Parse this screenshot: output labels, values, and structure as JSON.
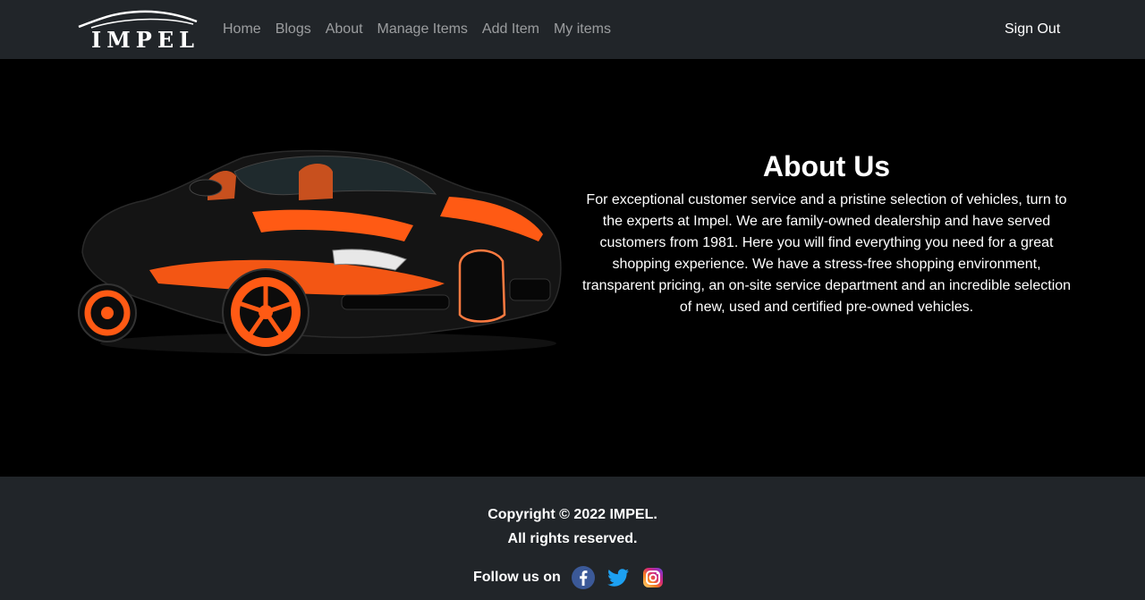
{
  "brand": {
    "name": "IMPEL"
  },
  "nav": {
    "links": [
      "Home",
      "Blogs",
      "About",
      "Manage Items",
      "Add Item",
      "My items"
    ],
    "sign_out": "Sign Out"
  },
  "about": {
    "title": "About Us",
    "text": "For exceptional customer service and a pristine selection of vehicles, turn to the experts at Impel. We are family-owned dealership and have served customers from 1981. Here you will find everything you need for a great shopping experience. We have a stress-free shopping environment, transparent pricing, an on-site service department and an incredible selection of new, used and certified pre-owned vehicles."
  },
  "footer": {
    "copyright": "Copyright © 2022 IMPEL.",
    "rights": "All rights reserved.",
    "follow": "Follow us on",
    "social_icons": [
      "facebook-icon",
      "twitter-icon",
      "instagram-icon"
    ]
  },
  "colors": {
    "nav_bg": "#212529",
    "hero_bg": "#000000",
    "accent_orange": "#ff5a14",
    "facebook": "#3b5998",
    "twitter": "#1da1f2"
  }
}
